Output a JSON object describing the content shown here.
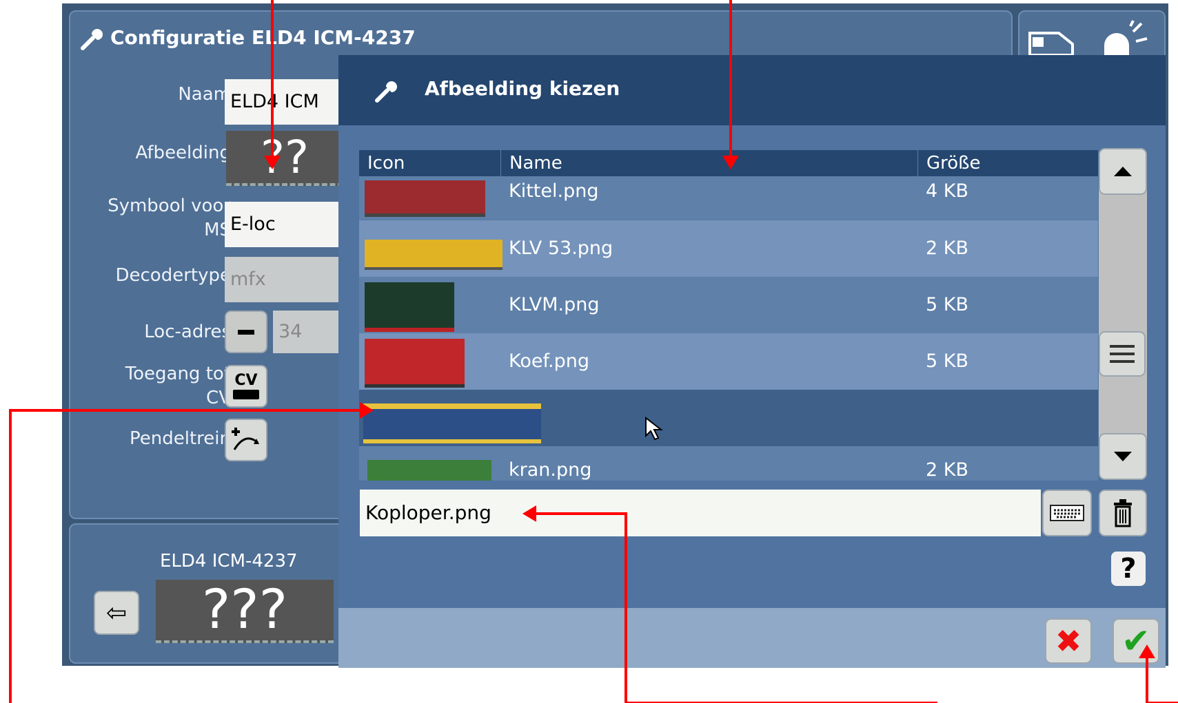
{
  "config": {
    "title": "Configuratie ELD4 ICM-4237",
    "fields": {
      "name_label": "Naam",
      "name_value": "ELD4 ICM",
      "image_label": "Afbeelding",
      "image_value": "??",
      "symbol_label_1": "Symbool voor",
      "symbol_label_2": "MS",
      "symbol_value": "E-loc",
      "decoder_label": "Decodertype",
      "decoder_value": "mfx",
      "address_label": "Loc-adres",
      "address_value": "34",
      "cv_label_1": "Toegang tot",
      "cv_label_2": "CV",
      "cv_button_text": "CV",
      "shuttle_label": "Pendeltrein"
    },
    "loco_card": {
      "name": "ELD4 ICM-4237",
      "image_placeholder": "???",
      "back_symbol": "⇦"
    }
  },
  "dialog": {
    "title": "Afbeelding kiezen",
    "columns": [
      "Icon",
      "Name",
      "Größe"
    ],
    "rows": [
      {
        "name": "Kittel.png",
        "size": "4 KB"
      },
      {
        "name": "KLV 53.png",
        "size": "2 KB"
      },
      {
        "name": "KLVM.png",
        "size": "5 KB"
      },
      {
        "name": "Koef.png",
        "size": "5 KB"
      },
      {
        "name": "",
        "size": ""
      },
      {
        "name": "kran.png",
        "size": "2 KB"
      }
    ],
    "filename": "Koploper.png",
    "help_symbol": "?",
    "cancel_symbol": "✖",
    "ok_symbol": "✔"
  },
  "colors": {
    "panel": "#4f6f95",
    "dialog_header": "#24466f",
    "selected_row": "#3f6089",
    "arrow": "#ff0000"
  }
}
